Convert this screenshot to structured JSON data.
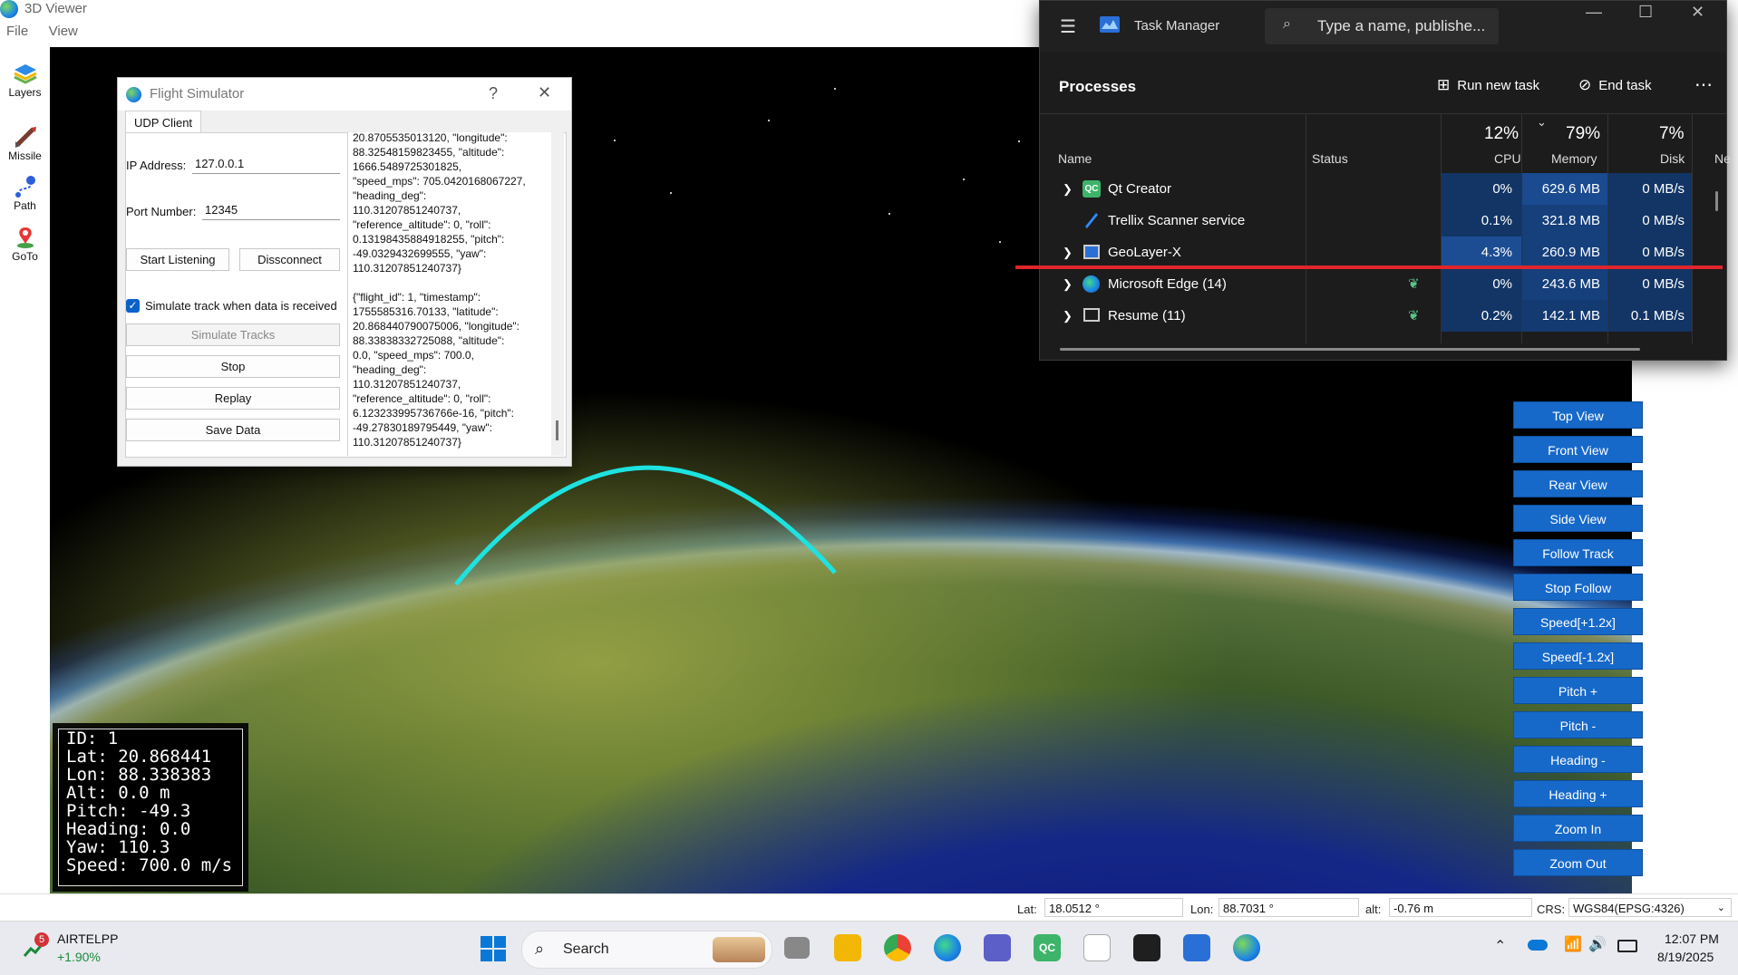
{
  "viewer": {
    "title": "3D Viewer",
    "menu": [
      "File",
      "View"
    ],
    "toolbar": [
      {
        "label": "Layers",
        "icon": "layers-icon"
      },
      {
        "label": "Missile",
        "icon": "missile-icon"
      },
      {
        "label": "Path",
        "icon": "path-icon"
      },
      {
        "label": "GoTo",
        "icon": "goto-pin-icon"
      }
    ],
    "view_buttons": [
      "Top View",
      "Front View",
      "Rear View",
      "Side View",
      "Follow Track",
      "Stop Follow",
      "Speed[+1.2x]",
      "Speed[-1.2x]",
      "Pitch +",
      "Pitch -",
      "Heading -",
      "Heading +",
      "Zoom In",
      "Zoom Out"
    ],
    "hud": {
      "id": "ID: 1",
      "lat": "Lat: 20.868441",
      "lon": "Lon: 88.338383",
      "alt": "Alt: 0.0 m",
      "pitch": "Pitch: -49.3",
      "heading": "Heading: 0.0",
      "yaw": "Yaw: 110.3",
      "speed": "Speed: 700.0 m/s"
    },
    "status": {
      "lat_label": "Lat:",
      "lat_value": "18.0512 °",
      "lon_label": "Lon:",
      "lon_value": "88.7031 °",
      "alt_label": "alt:",
      "alt_value": "-0.76 m",
      "crs_label": "CRS:",
      "crs_value": "WGS84(EPSG:4326)"
    },
    "track_color": "#1de3e0"
  },
  "flight_sim": {
    "title": "Flight Simulator",
    "help": "?",
    "close": "✕",
    "tab": "UDP Client",
    "ip_label": "IP Address:",
    "ip_value": "127.0.0.1",
    "port_label": "Port Number:",
    "port_value": "12345",
    "start_listening": "Start Listening",
    "disconnect": "Dissconnect",
    "simulate_check_label": "Simulate track when data is received",
    "simulate_checked": true,
    "simulate_tracks": "Simulate Tracks",
    "stop": "Stop",
    "replay": "Replay",
    "save_data": "Save Data",
    "log_text": "20.8705535013120, \"longitude\":\n88.32548159823455, \"altitude\":\n1666.5489725301825,\n\"speed_mps\": 705.0420168067227,\n\"heading_deg\":\n110.31207851240737,\n\"reference_altitude\": 0, \"roll\":\n0.13198435884918255, \"pitch\":\n-49.0329432699555, \"yaw\":\n110.31207851240737}\n\n{\"flight_id\": 1, \"timestamp\":\n1755585316.70133, \"latitude\":\n20.868440790075006, \"longitude\":\n88.33838332725088, \"altitude\":\n0.0, \"speed_mps\": 700.0,\n\"heading_deg\":\n110.31207851240737,\n\"reference_altitude\": 0, \"roll\":\n6.123233995736766e-16, \"pitch\":\n-49.27830189795449, \"yaw\":\n110.31207851240737}"
  },
  "task_manager": {
    "title": "Task Manager",
    "search_placeholder": "Type a name, publishe...",
    "section": "Processes",
    "run_new_task": "Run new task",
    "end_task": "End task",
    "columns": {
      "name": "Name",
      "status": "Status",
      "cpu": "CPU",
      "memory": "Memory",
      "disk": "Disk",
      "network": "Ne"
    },
    "totals": {
      "cpu": "12%",
      "memory": "79%",
      "disk": "7%"
    },
    "rows": [
      {
        "name": "Qt Creator",
        "status": "",
        "cpu": "0%",
        "memory": "629.6 MB",
        "disk": "0 MB/s",
        "icon": "qt-creator-icon",
        "expand": true
      },
      {
        "name": "Trellix Scanner service",
        "status": "",
        "cpu": "0.1%",
        "memory": "321.8 MB",
        "disk": "0 MB/s",
        "icon": "trellix-icon",
        "expand": false
      },
      {
        "name": "GeoLayer-X",
        "status": "",
        "cpu": "4.3%",
        "memory": "260.9 MB",
        "disk": "0 MB/s",
        "icon": "app-window-icon",
        "expand": true
      },
      {
        "name": "Microsoft Edge (14)",
        "status": "eco",
        "cpu": "0%",
        "memory": "243.6 MB",
        "disk": "0 MB/s",
        "icon": "edge-icon",
        "expand": true
      },
      {
        "name": "Resume (11)",
        "status": "eco",
        "cpu": "0.2%",
        "memory": "142.1 MB",
        "disk": "0.1 MB/s",
        "icon": "resume-icon",
        "expand": true
      }
    ]
  },
  "taskbar": {
    "stock_badge": "5",
    "stock_name": "AIRTELPP",
    "stock_change": "+1.90%",
    "search_label": "Search",
    "time": "12:07 PM",
    "date": "8/19/2025"
  }
}
